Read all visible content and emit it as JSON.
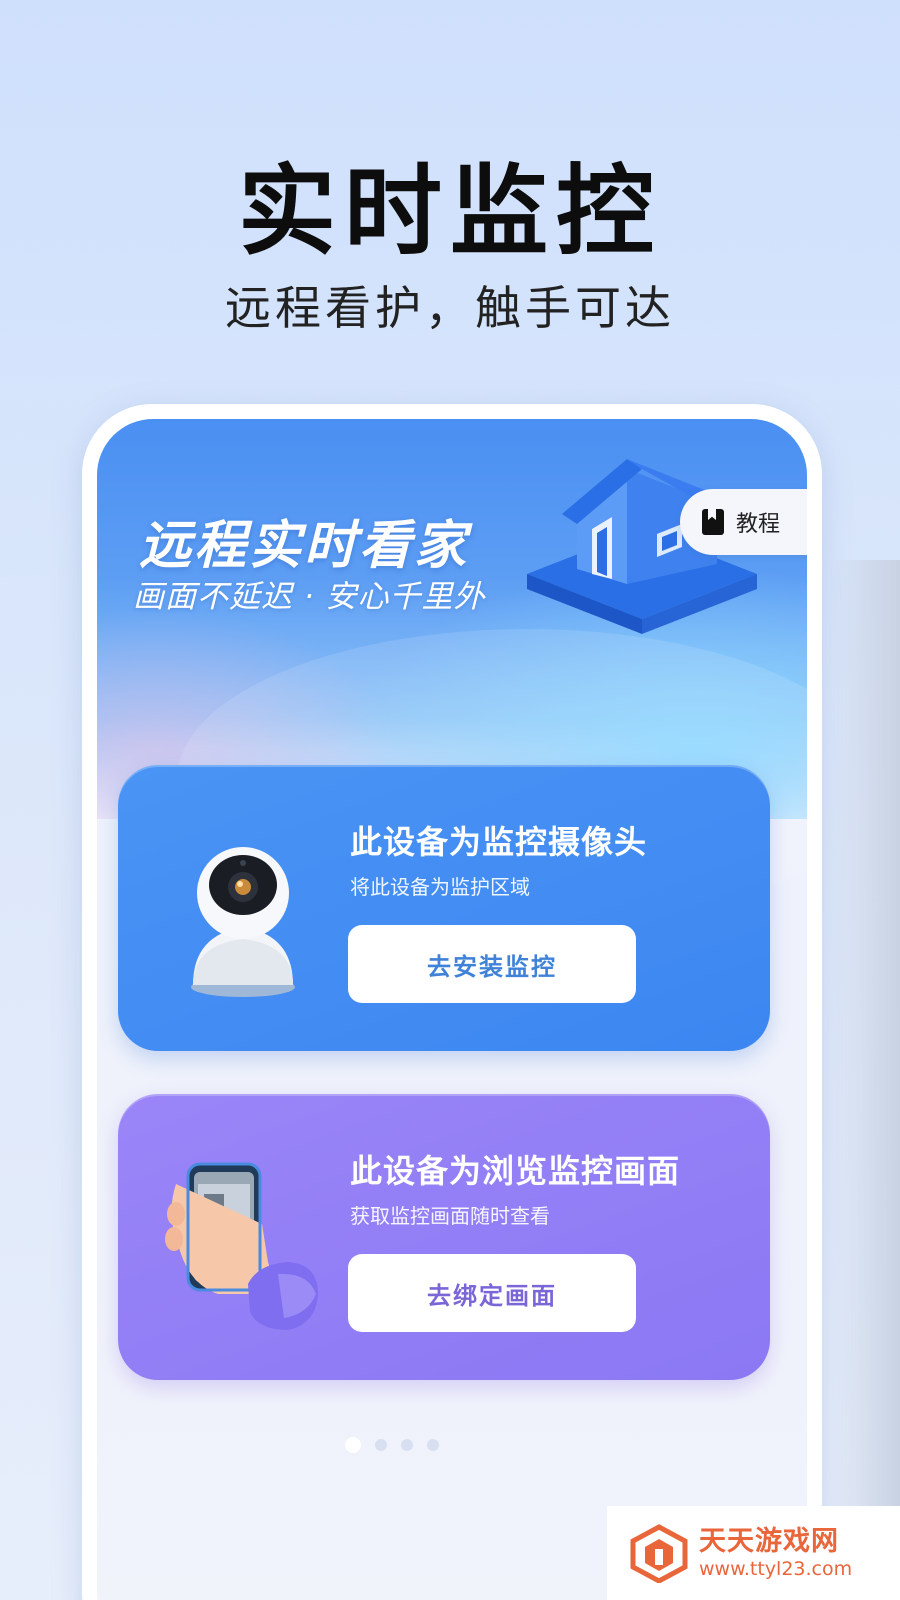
{
  "header": {
    "title": "实时监控",
    "subtitle": "远程看护，触手可达"
  },
  "phone": {
    "hero": {
      "title": "远程实时看家",
      "subtitle": "画面不延迟 · 安心千里外",
      "illustration": "house-icon"
    },
    "tutorial_button": {
      "label": "教程",
      "icon": "bookmark-icon"
    },
    "cards": [
      {
        "title": "此设备为监控摄像头",
        "description": "将此设备为监护区域",
        "button_label": "去安装监控",
        "illustration": "security-camera-icon",
        "color": "#3f87f2",
        "button_text_color": "#3f82d8"
      },
      {
        "title": "此设备为浏览监控画面",
        "description": "获取监控画面随时查看",
        "button_label": "去绑定画面",
        "illustration": "phone-in-hand-icon",
        "color": "#8f7cf5",
        "button_text_color": "#7b66d8"
      }
    ],
    "pagination": {
      "total": 4,
      "active": 1
    }
  },
  "watermark": {
    "name": "天天游戏网",
    "url": "www.ttyl23.com",
    "color": "#e9663b"
  }
}
